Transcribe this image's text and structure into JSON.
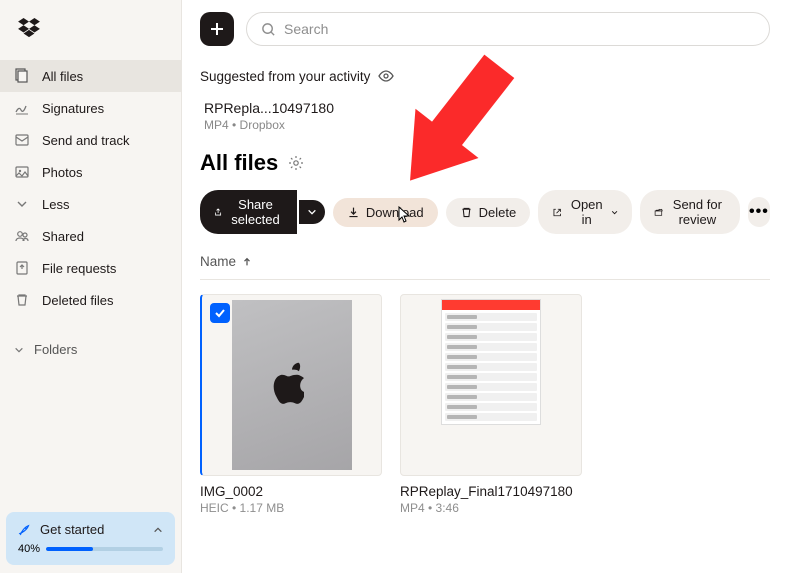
{
  "sidebar": {
    "items": [
      {
        "label": "All files",
        "icon": "files",
        "active": true
      },
      {
        "label": "Signatures",
        "icon": "signature"
      },
      {
        "label": "Send and track",
        "icon": "send"
      },
      {
        "label": "Photos",
        "icon": "photos"
      },
      {
        "label": "Less",
        "icon": "chevron-down"
      },
      {
        "label": "Shared",
        "icon": "shared"
      },
      {
        "label": "File requests",
        "icon": "request"
      },
      {
        "label": "Deleted files",
        "icon": "trash"
      }
    ],
    "folders_label": "Folders"
  },
  "get_started": {
    "label": "Get started",
    "percent": "40%"
  },
  "search": {
    "placeholder": "Search"
  },
  "suggested": {
    "label": "Suggested from your activity",
    "file_name": "RPRepla...10497180",
    "file_meta": "MP4 • Dropbox"
  },
  "page": {
    "title": "All files",
    "sort_column": "Name"
  },
  "actions": {
    "share": "Share selected",
    "download": "Download",
    "delete": "Delete",
    "open_in": "Open in",
    "review": "Send for review"
  },
  "files": [
    {
      "name": "IMG_0002",
      "meta": "HEIC • 1.17 MB",
      "selected": true,
      "kind": "apple"
    },
    {
      "name": "RPReplay_Final1710497180",
      "meta": "MP4 • 3:46",
      "selected": false,
      "kind": "phone"
    }
  ],
  "colors": {
    "accent": "#0061fe"
  }
}
